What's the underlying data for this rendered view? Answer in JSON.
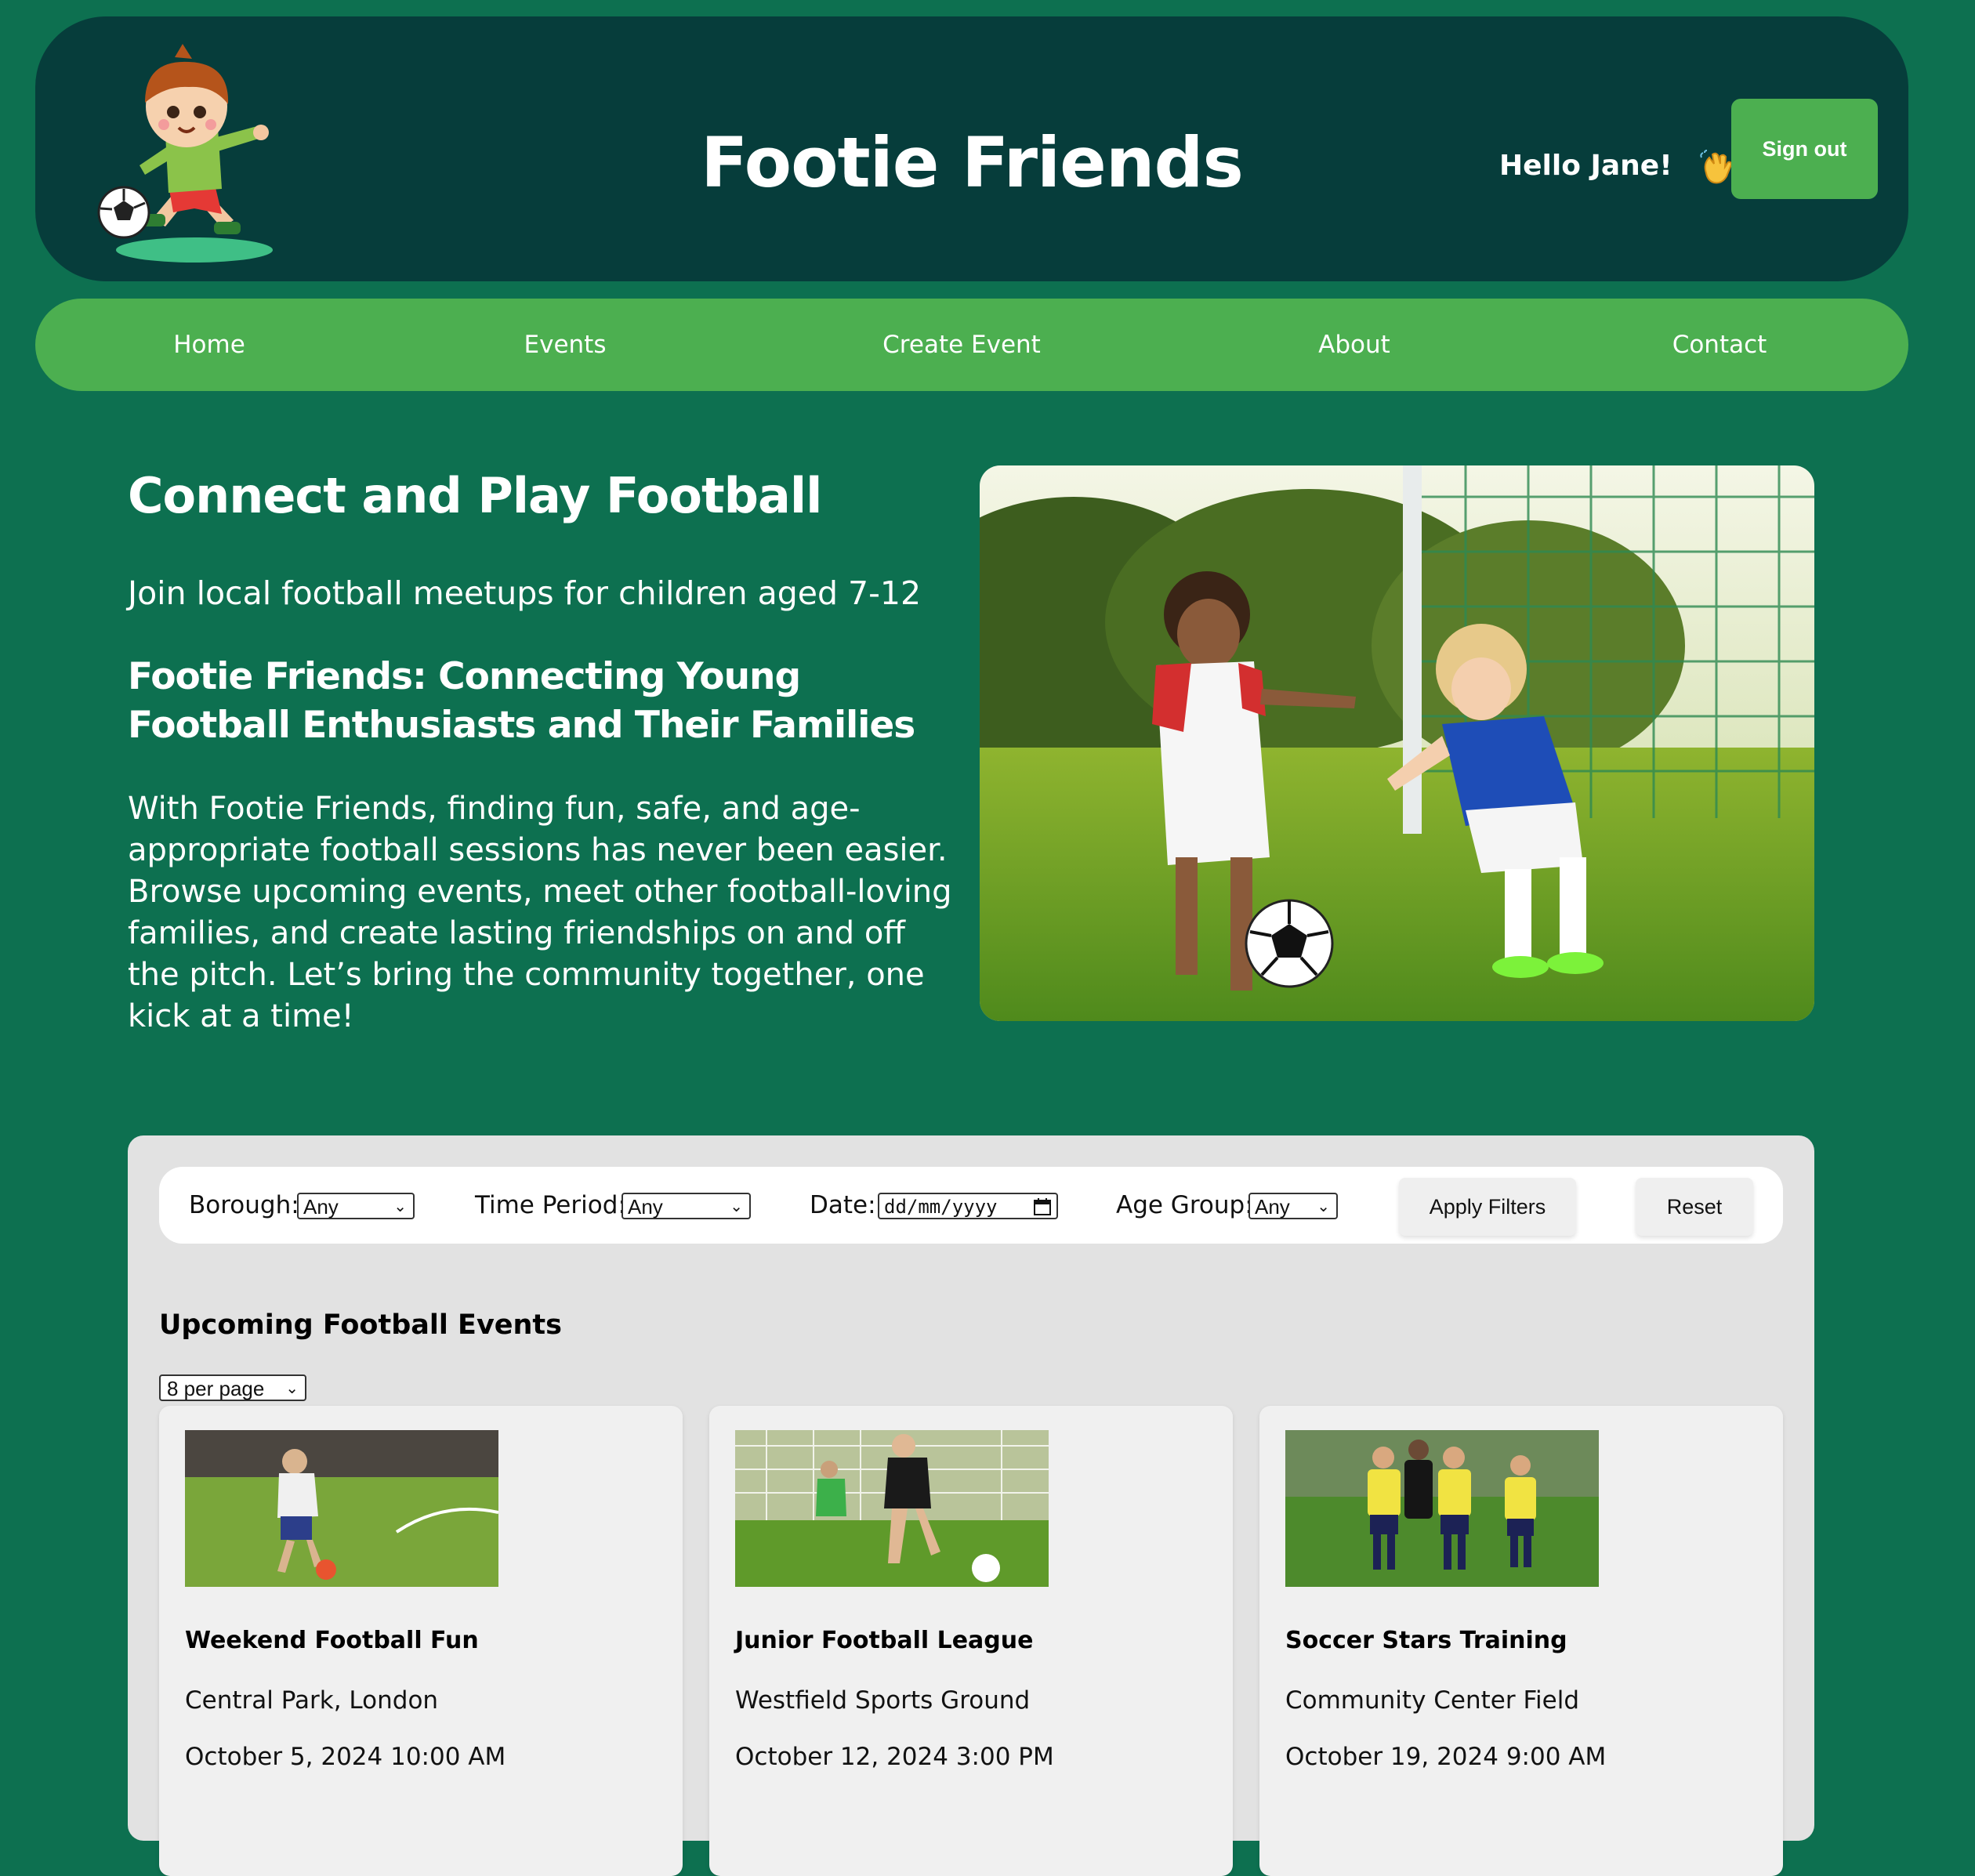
{
  "header": {
    "title": "Footie Friends",
    "greeting": "Hello Jane!",
    "wave_icon": "waving-hand-icon",
    "signout_label": "Sign out"
  },
  "nav": {
    "items": [
      {
        "label": "Home"
      },
      {
        "label": "Events"
      },
      {
        "label": "Create Event"
      },
      {
        "label": "About"
      },
      {
        "label": "Contact"
      }
    ]
  },
  "hero": {
    "title": "Connect and Play Football",
    "subtitle": "Join local football meetups for children aged 7-12",
    "heading": "Footie Friends: Connecting Young Football Enthusiasts and Their Families",
    "body": "With Footie Friends, finding fun, safe, and age-appropriate football sessions has never been easier. Browse upcoming events, meet other football-loving families, and create lasting friendships on and off the pitch. Let’s bring the community together, one kick at a time!"
  },
  "filters": {
    "borough_label": "Borough:",
    "borough_value": "Any",
    "time_label": "Time Period:",
    "time_value": "Any",
    "date_label": "Date:",
    "date_placeholder": "dd/mm/yyyy",
    "age_label": "Age Group:",
    "age_value": "Any",
    "apply_label": "Apply Filters",
    "reset_label": "Reset"
  },
  "events": {
    "title": "Upcoming Football Events",
    "per_page": "8 per page",
    "cards": [
      {
        "title": "Weekend Football Fun",
        "location": "Central Park, London",
        "datetime": "October 5, 2024 10:00 AM"
      },
      {
        "title": "Junior Football League",
        "location": "Westfield Sports Ground",
        "datetime": "October 12, 2024 3:00 PM"
      },
      {
        "title": "Soccer Stars Training",
        "location": "Community Center Field",
        "datetime": "October 19, 2024 9:00 AM"
      }
    ]
  },
  "colors": {
    "page_bg": "#0d7050",
    "header_bg": "#063d3b",
    "accent": "#4caf50",
    "panel_bg": "#e2e2e2"
  }
}
